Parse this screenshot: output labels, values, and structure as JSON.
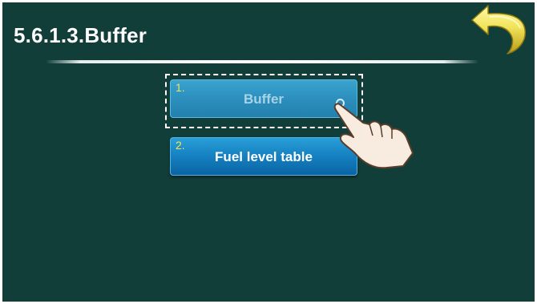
{
  "header": {
    "title": "5.6.1.3.Buffer"
  },
  "icons": {
    "back": "back-arrow-icon",
    "pointer": "hand-pointer-icon",
    "radio": "radio-indicator-icon"
  },
  "menu": {
    "items": [
      {
        "number": "1.",
        "label": "Buffer",
        "selected": true
      },
      {
        "number": "2.",
        "label": "Fuel level table",
        "selected": false
      }
    ]
  },
  "colors": {
    "background": "#123e3a",
    "button_primary": "#1683c3",
    "button_selected": "#2c8fbd",
    "number_label": "#f2e84a",
    "back_arrow": "#f1e35a"
  }
}
